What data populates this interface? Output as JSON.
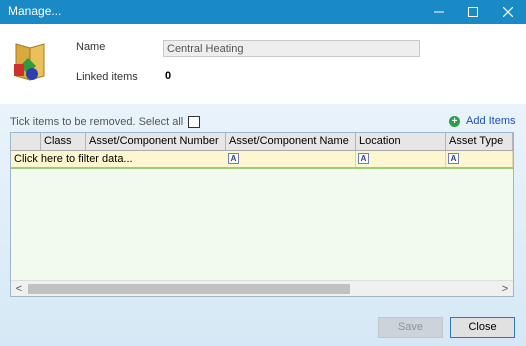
{
  "window": {
    "title": "Manage..."
  },
  "header": {
    "name_label": "Name",
    "name_value": "Central Heating",
    "linked_label": "Linked items",
    "linked_value": "0"
  },
  "toolbar": {
    "tick_label": "Tick items to be removed. Select all",
    "add_items_label": "Add Items"
  },
  "grid": {
    "columns": [
      "Class",
      "Asset/Component Number",
      "Asset/Component Name",
      "Location",
      "Asset Type"
    ],
    "filter_placeholder": "Click here to filter data...",
    "filter_icon_glyph": "A"
  },
  "scroll": {
    "left_arrow": "<",
    "right_arrow": ">"
  },
  "buttons": {
    "save": "Save",
    "close": "Close"
  },
  "colors": {
    "titlebar": "#1a8ac6",
    "add_icon": "#2aa04a",
    "filter_row": "#fdf7d0"
  }
}
